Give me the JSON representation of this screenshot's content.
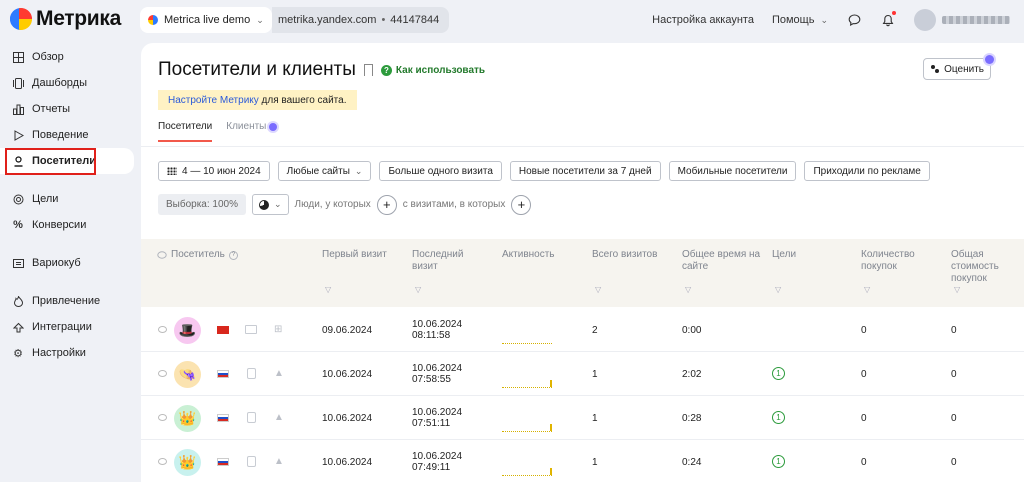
{
  "app": {
    "logo_text": "Метрика"
  },
  "header": {
    "counter_name": "Metrica live demo",
    "site": "metrika.yandex.com",
    "separator": "•",
    "counter_id": "44147844",
    "account_settings": "Настройка аккаунта",
    "help": "Помощь"
  },
  "sidebar": {
    "items": [
      {
        "label": "Обзор",
        "icon": "grid-icon"
      },
      {
        "label": "Дашборды",
        "icon": "dashboard-icon"
      },
      {
        "label": "Отчеты",
        "icon": "bar-chart-icon"
      },
      {
        "label": "Поведение",
        "icon": "play-icon"
      },
      {
        "label": "Посетители",
        "icon": "person-icon",
        "active": true
      },
      {
        "label": "Цели",
        "icon": "target-icon"
      },
      {
        "label": "Конверсии",
        "icon": "percent-icon"
      },
      {
        "label": "Вариокуб",
        "icon": "cube-icon"
      },
      {
        "label": "Привлечение",
        "icon": "flame-icon"
      },
      {
        "label": "Интеграции",
        "icon": "integration-icon"
      },
      {
        "label": "Настройки",
        "icon": "gear-icon"
      }
    ]
  },
  "page": {
    "title": "Посетители и клиенты",
    "how_to_use": "Как использовать",
    "rate_button": "Оценить",
    "notice_link": "Настройте Метрику",
    "notice_rest": " для вашего сайта.",
    "tabs": [
      "Посетители",
      "Клиенты"
    ]
  },
  "filters": {
    "date_range": "4 — 10 июн 2024",
    "sites": "Любые сайты",
    "more_than_one": "Больше одного визита",
    "new_visitors": "Новые посетители за 7 дней",
    "mobile": "Мобильные посетители",
    "from_ads": "Приходили по рекламе",
    "sample": "Выборка: 100%",
    "people_where": "Люди, у которых",
    "visits_where": "с визитами, в которых"
  },
  "table": {
    "columns": [
      "Посетитель",
      "Первый визит",
      "Последний визит",
      "Активность",
      "Всего визитов",
      "Общее время на сайте",
      "Цели",
      "Количество покупок",
      "Общая стоимость покупок"
    ],
    "rows": [
      {
        "avatar_color": "#f7c8f0",
        "avatar_glyph": "🎩",
        "country": "cn",
        "first": "09.06.2024",
        "last_date": "10.06.2024",
        "last_time": "08:11:58",
        "visits": "2",
        "time": "0:00",
        "goals": "",
        "purchases": "0",
        "cost": "0",
        "activity": 0
      },
      {
        "avatar_color": "#fbe3b0",
        "avatar_glyph": "👒",
        "country": "ru",
        "first": "10.06.2024",
        "last_date": "10.06.2024",
        "last_time": "07:58:55",
        "visits": "1",
        "time": "2:02",
        "goals": "1",
        "purchases": "0",
        "cost": "0",
        "activity": 1
      },
      {
        "avatar_color": "#c9f0d4",
        "avatar_glyph": "👑",
        "country": "ru",
        "first": "10.06.2024",
        "last_date": "10.06.2024",
        "last_time": "07:51:11",
        "visits": "1",
        "time": "0:28",
        "goals": "1",
        "purchases": "0",
        "cost": "0",
        "activity": 1
      },
      {
        "avatar_color": "#c8f1ee",
        "avatar_glyph": "👑",
        "country": "ru",
        "first": "10.06.2024",
        "last_date": "10.06.2024",
        "last_time": "07:49:11",
        "visits": "1",
        "time": "0:24",
        "goals": "1",
        "purchases": "0",
        "cost": "0",
        "activity": 1
      }
    ]
  }
}
